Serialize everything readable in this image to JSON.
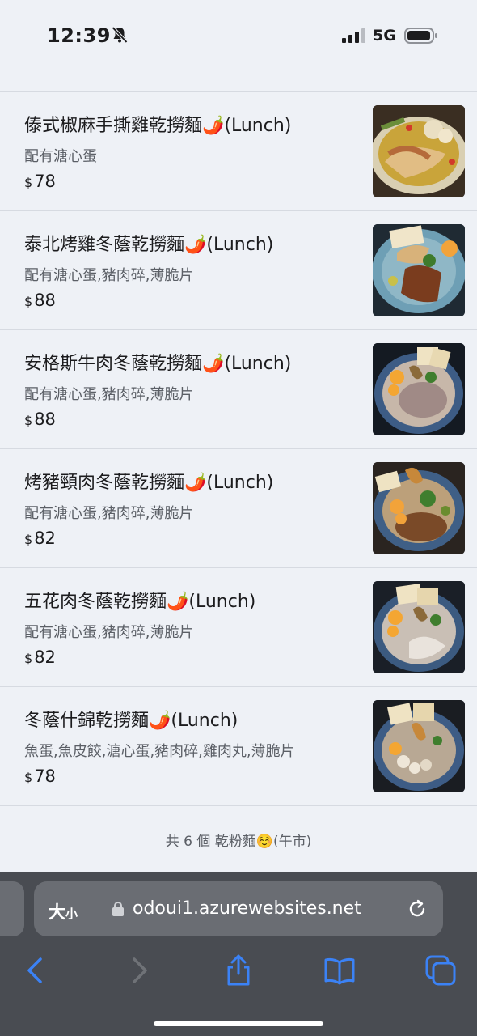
{
  "status_bar": {
    "time": "12:39",
    "network": "5G",
    "icons": [
      "bell-slash-icon",
      "signal-icon",
      "battery-icon"
    ]
  },
  "menu": {
    "items": [
      {
        "name": "傣式椒麻手撕雞乾撈麵🌶️(Lunch)",
        "description": "配有溏心蛋",
        "currency": "$",
        "price": "78",
        "image": "dish-photo"
      },
      {
        "name": "泰北烤雞冬蔭乾撈麵🌶️(Lunch)",
        "description": "配有溏心蛋,豬肉碎,薄脆片",
        "currency": "$",
        "price": "88",
        "image": "dish-photo"
      },
      {
        "name": "安格斯牛肉冬蔭乾撈麵🌶️(Lunch)",
        "description": "配有溏心蛋,豬肉碎,薄脆片",
        "currency": "$",
        "price": "88",
        "image": "dish-photo"
      },
      {
        "name": "烤豬頸肉冬蔭乾撈麵🌶️(Lunch)",
        "description": "配有溏心蛋,豬肉碎,薄脆片",
        "currency": "$",
        "price": "82",
        "image": "dish-photo"
      },
      {
        "name": "五花肉冬蔭乾撈麵🌶️(Lunch)",
        "description": "配有溏心蛋,豬肉碎,薄脆片",
        "currency": "$",
        "price": "82",
        "image": "dish-photo"
      },
      {
        "name": "冬蔭什錦乾撈麵🌶️(Lunch)",
        "description": "魚蛋,魚皮餃,溏心蛋,豬肉碎,雞肉丸,薄脆片",
        "currency": "$",
        "price": "78",
        "image": "dish-photo"
      }
    ],
    "footer": "共 6 個 乾粉麵☺️(午市)"
  },
  "browser": {
    "text_size_label_large": "大",
    "text_size_label_small": "小",
    "url": "odoui1.azurewebsites.net",
    "toolbar_icons": [
      "back-icon",
      "forward-icon",
      "share-icon",
      "bookmarks-icon",
      "tabs-icon"
    ]
  },
  "colors": {
    "page_background": "#eef1f6",
    "toolbar_background": "#494c52",
    "accent": "#3b82f6"
  }
}
